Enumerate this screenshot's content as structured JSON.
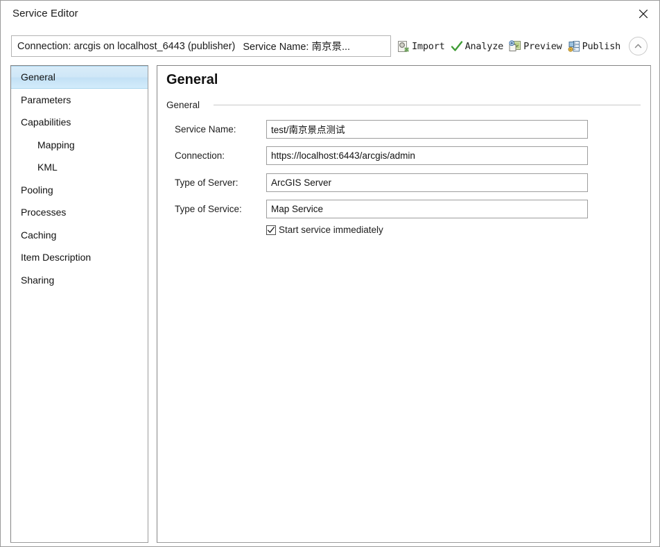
{
  "window": {
    "title": "Service Editor",
    "close_icon": "close-icon"
  },
  "toolbar": {
    "connection_label": "Connection: arcgis on localhost_6443 (publisher)",
    "service_name_label": "Service Name: 南京景...",
    "buttons": [
      {
        "label": "Import",
        "icon": "import-icon"
      },
      {
        "label": "Analyze",
        "icon": "checkmark-icon"
      },
      {
        "label": "Preview",
        "icon": "preview-icon"
      },
      {
        "label": "Publish",
        "icon": "publish-icon"
      }
    ],
    "collapse_icon": "chevron-up-icon"
  },
  "sidebar": {
    "items": [
      {
        "label": "General",
        "selected": true,
        "indent": false
      },
      {
        "label": "Parameters",
        "selected": false,
        "indent": false
      },
      {
        "label": "Capabilities",
        "selected": false,
        "indent": false
      },
      {
        "label": "Mapping",
        "selected": false,
        "indent": true
      },
      {
        "label": "KML",
        "selected": false,
        "indent": true
      },
      {
        "label": "Pooling",
        "selected": false,
        "indent": false
      },
      {
        "label": "Processes",
        "selected": false,
        "indent": false
      },
      {
        "label": "Caching",
        "selected": false,
        "indent": false
      },
      {
        "label": "Item Description",
        "selected": false,
        "indent": false
      },
      {
        "label": "Sharing",
        "selected": false,
        "indent": false
      }
    ]
  },
  "main": {
    "page_title": "General",
    "section_label": "General",
    "fields": [
      {
        "label": "Service Name:",
        "value": "test/南京景点测试"
      },
      {
        "label": "Connection:",
        "value": "https://localhost:6443/arcgis/admin"
      },
      {
        "label": "Type of Server:",
        "value": "ArcGIS Server"
      },
      {
        "label": "Type of Service:",
        "value": "Map Service"
      }
    ],
    "checkbox": {
      "label": "Start service immediately",
      "checked": true
    }
  },
  "colors": {
    "selection_blue": "#cfe7f7",
    "accent_green": "#3f9c35",
    "border_gray": "#9d9d9d",
    "text": "#111111"
  }
}
